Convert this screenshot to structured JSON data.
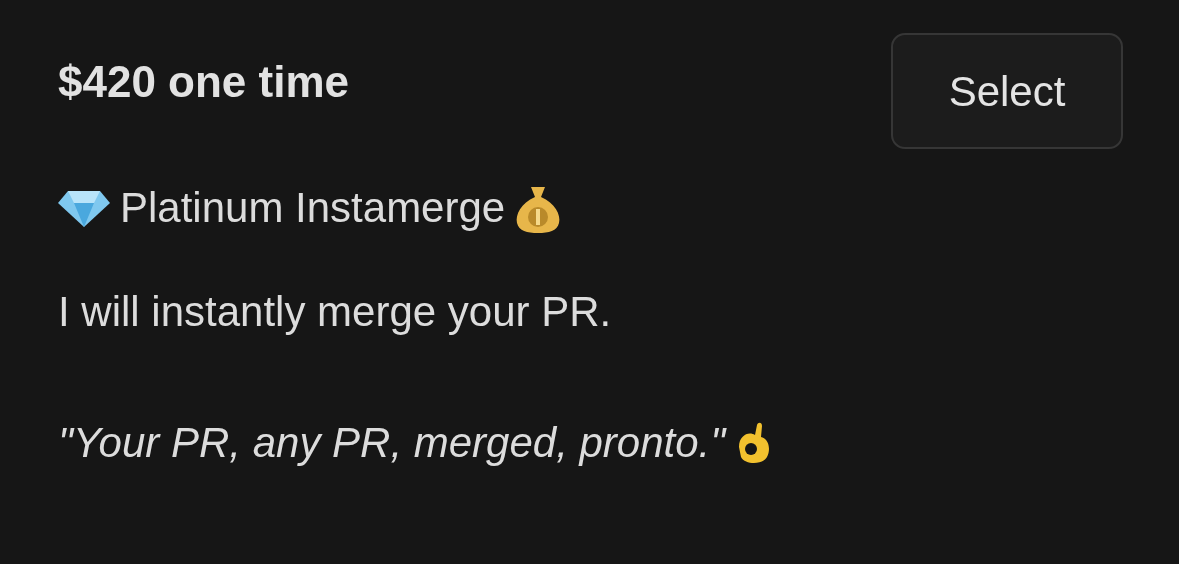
{
  "plan": {
    "price": "$420 one time",
    "button": "Select",
    "name": "Platinum Instamerge",
    "description": "I will instantly merge your PR.",
    "tagline": "\"Your PR, any PR, merged, pronto.\""
  }
}
